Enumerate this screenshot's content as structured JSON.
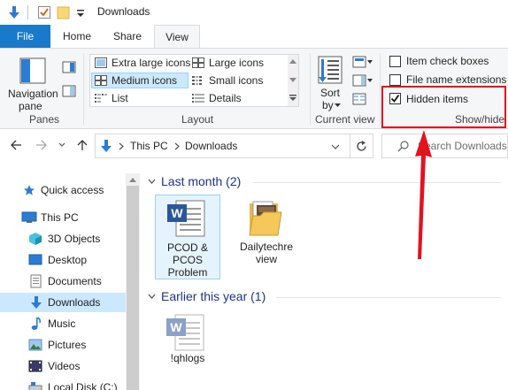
{
  "window": {
    "title": "Downloads"
  },
  "ribbon_tabs": [
    {
      "label": "File"
    },
    {
      "label": "Home"
    },
    {
      "label": "Share"
    },
    {
      "label": "View"
    }
  ],
  "ribbon": {
    "panes": {
      "navigation_pane_label_1": "Navigation",
      "navigation_pane_label_2": "pane",
      "group_label": "Panes"
    },
    "layout": {
      "options": [
        {
          "label": "Extra large icons"
        },
        {
          "label": "Large icons"
        },
        {
          "label": "Medium icons",
          "selected": true
        },
        {
          "label": "Small icons"
        },
        {
          "label": "List"
        },
        {
          "label": "Details"
        }
      ],
      "group_label": "Layout"
    },
    "current_view": {
      "sort_label_1": "Sort",
      "sort_label_2": "by",
      "group_label": "Current view"
    },
    "show_hide": {
      "item_check_boxes": {
        "label": "Item check boxes",
        "checked": false
      },
      "file_name_extensions": {
        "label": "File name extensions",
        "checked": false
      },
      "hidden_items": {
        "label": "Hidden items",
        "checked": true
      },
      "group_label": "Show/hide"
    }
  },
  "address_bar": {
    "crumbs": [
      "This PC",
      "Downloads"
    ],
    "search_placeholder": "Search Downloads"
  },
  "nav_pane": {
    "items": [
      {
        "label": "Quick access",
        "icon": "star-icon"
      },
      {
        "label": "This PC",
        "icon": "computer-icon"
      },
      {
        "label": "3D Objects",
        "icon": "3d-objects-icon"
      },
      {
        "label": "Desktop",
        "icon": "desktop-icon"
      },
      {
        "label": "Documents",
        "icon": "documents-icon"
      },
      {
        "label": "Downloads",
        "icon": "downloads-icon",
        "selected": true
      },
      {
        "label": "Music",
        "icon": "music-icon"
      },
      {
        "label": "Pictures",
        "icon": "pictures-icon"
      },
      {
        "label": "Videos",
        "icon": "videos-icon"
      },
      {
        "label": "Local Disk (C:)",
        "icon": "disk-icon"
      }
    ]
  },
  "content": {
    "groups": [
      {
        "header": "Last month (2)",
        "files": [
          {
            "name_line1": "PCOD &",
            "name_line2": "PCOS",
            "name_line3": "Problem",
            "type": "word-document"
          },
          {
            "name_line1": "Dailytechre",
            "name_line2": "view",
            "type": "folder"
          }
        ]
      },
      {
        "header": "Earlier this year (1)",
        "files": [
          {
            "name_line1": "!qhlogs",
            "type": "word-document-hidden"
          }
        ]
      }
    ]
  },
  "colors": {
    "accent": "#1979ca",
    "selection": "#cce8ff",
    "highlight_box": "#e0141e",
    "header_text": "#1e3287"
  }
}
